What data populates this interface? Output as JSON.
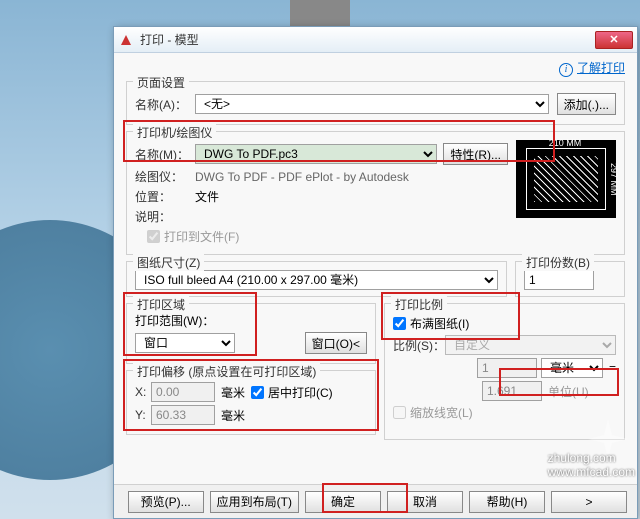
{
  "window": {
    "title": "打印 - 模型",
    "close": "✕"
  },
  "learn": {
    "label": "了解打印",
    "icon": "i"
  },
  "page_setup": {
    "legend": "页面设置",
    "name_label": "名称(A)：",
    "name_value": "<无>",
    "add_btn": "添加(.)..."
  },
  "printer": {
    "legend": "打印机/绘图仪",
    "name_label": "名称(M)：",
    "name_value": "DWG To PDF.pc3",
    "props_btn": "特性(R)...",
    "plotter_label": "绘图仪：",
    "plotter_value": "DWG To PDF - PDF ePlot - by Autodesk",
    "location_label": "位置：",
    "location_value": "文件",
    "desc_label": "说明：",
    "preview_w": "210 MM",
    "preview_h": "297 MM",
    "tofile_label": "打印到文件(F)"
  },
  "paper": {
    "legend": "图纸尺寸(Z)",
    "value": "ISO full bleed A4 (210.00 x 297.00 毫米)"
  },
  "copies": {
    "legend": "打印份数(B)",
    "value": "1"
  },
  "area": {
    "legend": "打印区域",
    "range_label": "打印范围(W)：",
    "range_value": "窗口",
    "window_btn": "窗口(O)<"
  },
  "offset": {
    "legend": "打印偏移 (原点设置在可打印区域)",
    "x_label": "X:",
    "x_value": "0.00",
    "x_unit": "毫米",
    "y_label": "Y:",
    "y_value": "60.33",
    "y_unit": "毫米",
    "center_label": "居中打印(C)"
  },
  "scale": {
    "legend": "打印比例",
    "fit_label": "布满图纸(I)",
    "scale_label": "比例(S)：",
    "scale_value": "自定义",
    "num_value": "1",
    "unit_value": "毫米",
    "den_value": "1.691",
    "den_unit": "单位(U)",
    "lw_label": "缩放线宽(L)"
  },
  "buttons": {
    "preview": "预览(P)...",
    "apply": "应用到布局(T)",
    "ok": "确定",
    "cancel": "取消",
    "help": "帮助(H)",
    "expand": ">"
  },
  "watermark": {
    "url1": "zhulong.com",
    "url2": "www.mfcad.com"
  }
}
